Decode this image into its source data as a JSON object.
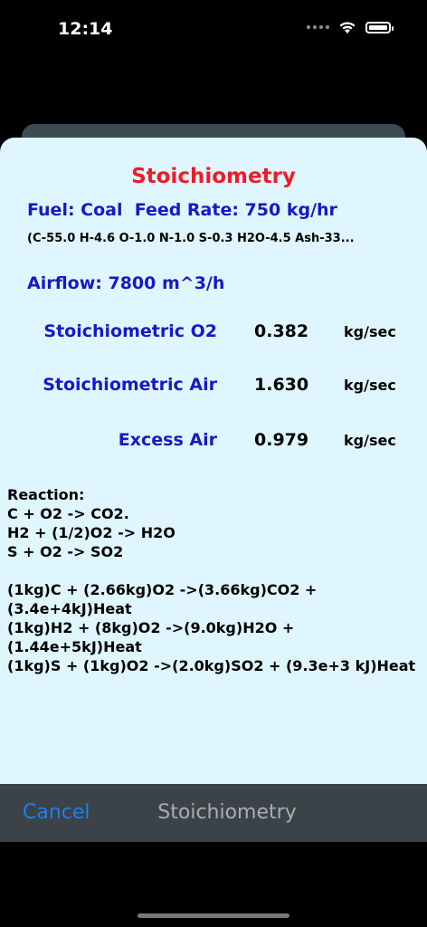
{
  "status": {
    "time": "12:14"
  },
  "sheet": {
    "title": "Stoichiometry",
    "fuel_line": "Fuel: Coal  Feed Rate: 750 kg/hr",
    "composition": "(C-55.0  H-4.6  O-1.0  N-1.0  S-0.3  H2O-4.5  Ash-33...",
    "airflow": "Airflow: 7800 m^3/h",
    "results": [
      {
        "label": "Stoichiometric O2",
        "value": "0.382",
        "unit": "kg/sec"
      },
      {
        "label": "Stoichiometric Air",
        "value": "1.630",
        "unit": "kg/sec"
      },
      {
        "label": "Excess Air",
        "value": "0.979",
        "unit": "kg/sec"
      }
    ],
    "reaction_lines": [
      "Reaction:",
      "C + O2 -> CO2.",
      "H2 + (1/2)O2 -> H2O",
      "S + O2 -> SO2",
      "",
      "(1kg)C + (2.66kg)O2 ->(3.66kg)CO2 +",
      "(3.4e+4kJ)Heat",
      "(1kg)H2 + (8kg)O2 ->(9.0kg)H2O +",
      "(1.44e+5kJ)Heat",
      "(1kg)S + (1kg)O2 ->(2.0kg)SO2 + (9.3e+3 kJ)Heat"
    ]
  },
  "toolbar": {
    "cancel_label": "Cancel",
    "title": "Stoichiometry"
  },
  "colors": {
    "title": "#ee1c2a",
    "label_blue": "#1818c8",
    "sheet_bg": "#e0f6fe",
    "toolbar_bg": "#3b4348",
    "link_blue": "#1e7ff0"
  },
  "icons": [
    "cellular-dots-icon",
    "wifi-icon",
    "battery-icon"
  ]
}
